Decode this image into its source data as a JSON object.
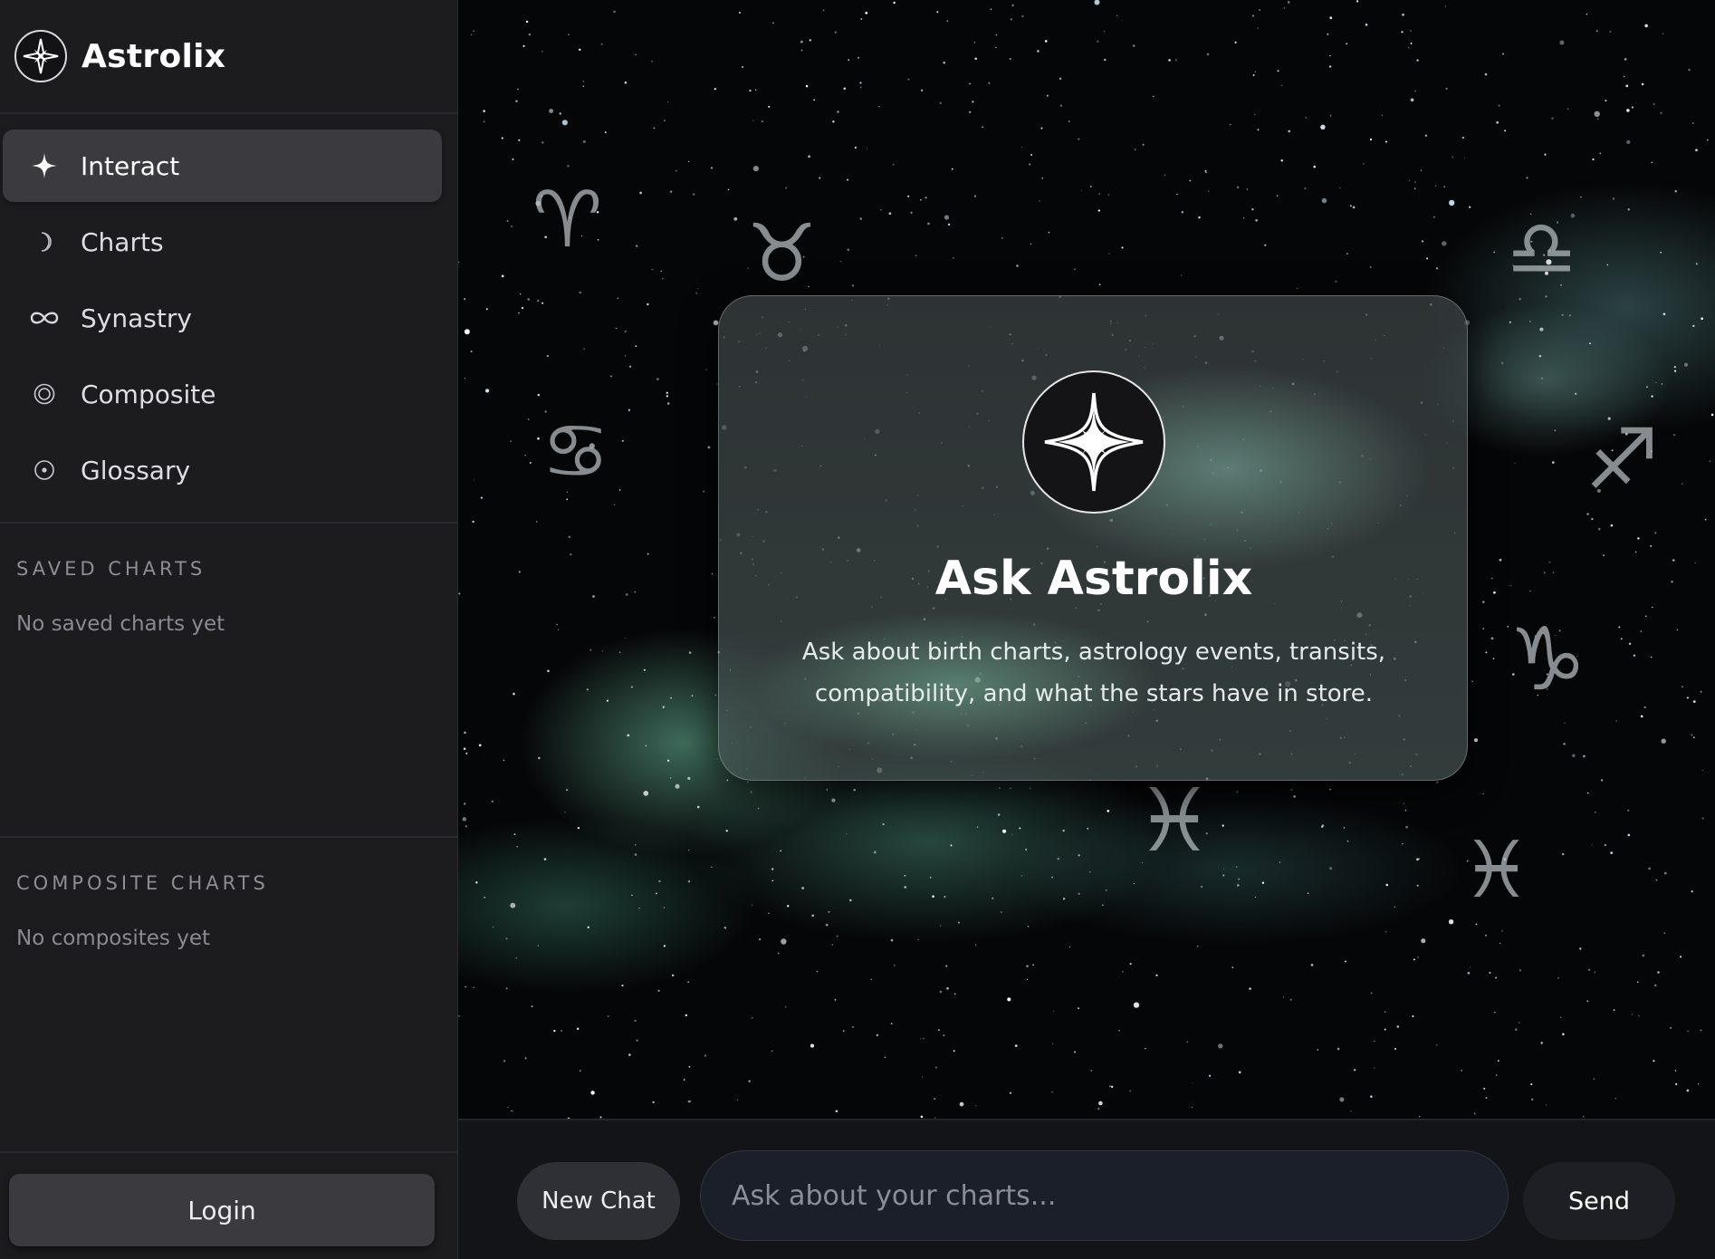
{
  "app": {
    "name": "Astrolix"
  },
  "sidebar": {
    "nav": [
      {
        "label": "Interact",
        "icon": "sparkle-icon",
        "active": true
      },
      {
        "label": "Charts",
        "icon": "moon-icon",
        "active": false
      },
      {
        "label": "Synastry",
        "icon": "infinity-icon",
        "active": false
      },
      {
        "label": "Composite",
        "icon": "concentric-circles-icon",
        "active": false
      },
      {
        "label": "Glossary",
        "icon": "dot-circle-icon",
        "active": false
      }
    ],
    "saved": {
      "title": "SAVED CHARTS",
      "empty": "No saved charts yet"
    },
    "composite": {
      "title": "COMPOSITE CHARTS",
      "empty": "No composites yet"
    },
    "login_label": "Login"
  },
  "hero": {
    "title": "Ask Astrolix",
    "subtitle": "Ask about birth charts, astrology events, transits, compatibility, and what the stars have in store."
  },
  "zodiac": {
    "aries": "♈",
    "taurus": "♉",
    "libra": "♎",
    "cancer": "♋",
    "sagittarius": "♐",
    "capricorn": "♑",
    "pisces_center": "♓",
    "pisces_right": "♓"
  },
  "composer": {
    "new_chat_label": "New Chat",
    "placeholder": "Ask about your charts...",
    "send_label": "Send"
  },
  "colors": {
    "sidebar_bg": "#1c1c1f",
    "active_nav_bg": "#3a3a3f",
    "sky_bg": "#050607",
    "nebula": "#6ebea0",
    "composer_bg": "#121418"
  }
}
